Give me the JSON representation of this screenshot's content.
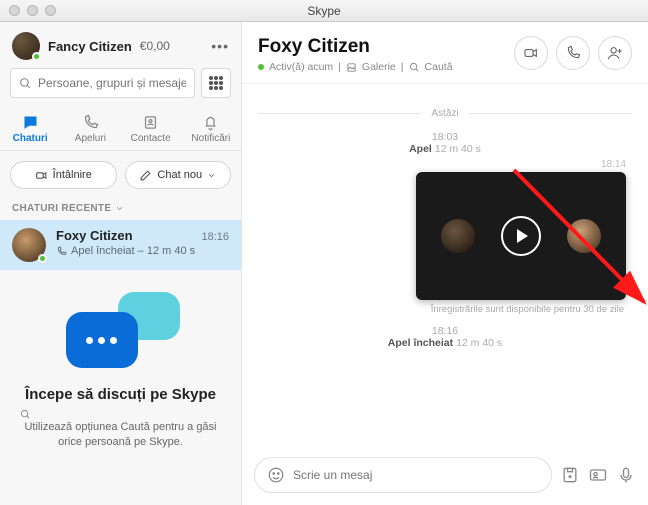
{
  "window": {
    "title": "Skype"
  },
  "sidebar": {
    "user": {
      "name": "Fancy Citizen",
      "balance": "€0,00"
    },
    "search_placeholder": "Persoane, grupuri și mesaje",
    "tabs": {
      "chats": "Chaturi",
      "calls": "Apeluri",
      "contacts": "Contacte",
      "notifications": "Notificări"
    },
    "actions": {
      "meet": "Întâlnire",
      "newchat": "Chat nou"
    },
    "section": "CHATURI RECENTE",
    "items": [
      {
        "name": "Foxy Citizen",
        "time": "18:16",
        "subtitle": "Apel încheiat – 12 m 40 s"
      }
    ],
    "empty": {
      "heading": "Începe să discuți pe Skype",
      "body": "Utilizează opțiunea Caută pentru a găsi orice persoană pe Skype."
    }
  },
  "main": {
    "header": {
      "name": "Foxy Citizen",
      "status": "Activ(ă) acum",
      "gallery": "Galerie",
      "search": "Caută"
    },
    "day": "Astăzi",
    "msg1": {
      "time": "18:03",
      "label": "Apel",
      "dur": "12 m 40 s"
    },
    "video": {
      "time": "18:14",
      "caption": "Înregistrările sunt disponibile pentru 30 de zile"
    },
    "msg2": {
      "time": "18:16",
      "label": "Apel încheiat",
      "dur": "12 m 40 s"
    },
    "composer_placeholder": "Scrie un mesaj"
  }
}
